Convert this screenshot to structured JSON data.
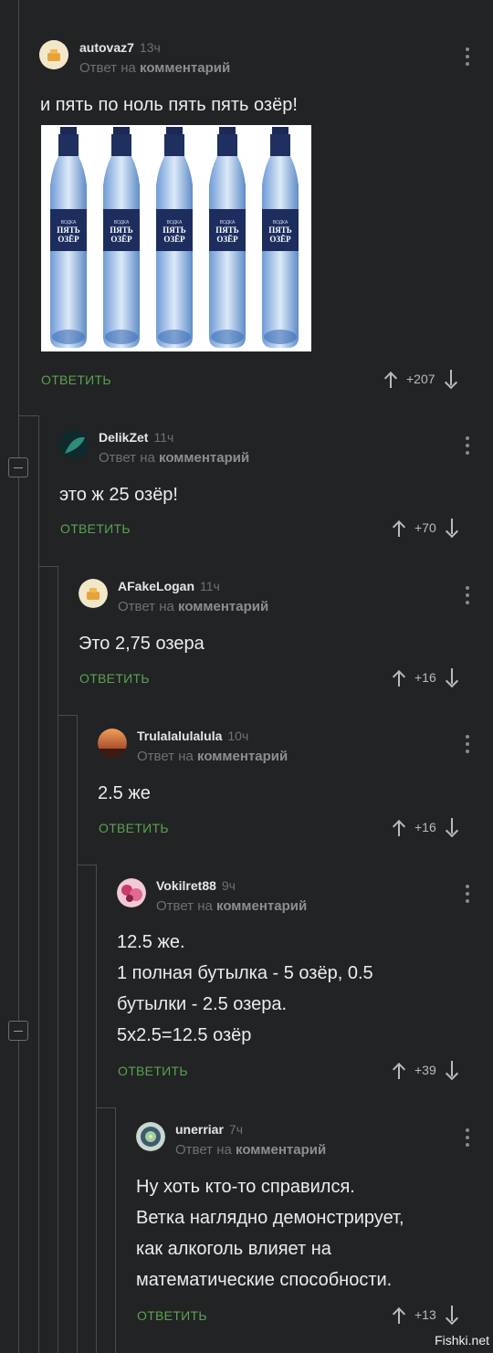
{
  "comments": [
    {
      "author": "autovaz7",
      "time": "13ч",
      "reply_prefix": "Ответ на",
      "reply_target": "комментарий",
      "text": "и пять по ноль пять пять озёр!",
      "reply_label": "ОТВЕТИТЬ",
      "score": "+207",
      "image": {
        "bottles": 5,
        "label_line1": "ПЯТЬ",
        "label_line2": "ОЗЁР",
        "label_small": "ВОДКА"
      }
    },
    {
      "author": "DelikZet",
      "time": "11ч",
      "reply_prefix": "Ответ на",
      "reply_target": "комментарий",
      "text": "это ж 25 озёр!",
      "reply_label": "ОТВЕТИТЬ",
      "score": "+70"
    },
    {
      "author": "AFakeLogan",
      "time": "11ч",
      "reply_prefix": "Ответ на",
      "reply_target": "комментарий",
      "text": "Это 2,75 озера",
      "reply_label": "ОТВЕТИТЬ",
      "score": "+16"
    },
    {
      "author": "Trulalalulalula",
      "time": "10ч",
      "reply_prefix": "Ответ на",
      "reply_target": "комментарий",
      "text": "2.5 же",
      "reply_label": "ОТВЕТИТЬ",
      "score": "+16"
    },
    {
      "author": "Vokilret88",
      "time": "9ч",
      "reply_prefix": "Ответ на",
      "reply_target": "комментарий",
      "text": "12.5 же.\n1 полная бутылка - 5 озёр, 0.5\nбутылки - 2.5 озера.\n5х2.5=12.5 озёр",
      "reply_label": "ОТВЕТИТЬ",
      "score": "+39"
    },
    {
      "author": "unerriar",
      "time": "7ч",
      "reply_prefix": "Ответ на",
      "reply_target": "комментарий",
      "text": "Ну хоть кто-то справился.\nВетка наглядно демонстрирует,\nкак алкоголь влияет на\nматематические способности.",
      "reply_label": "ОТВЕТИТЬ",
      "score": "+13"
    }
  ],
  "watermark": "Fishki.net",
  "colors": {
    "background": "#222325",
    "accent_green": "#59a34f",
    "muted": "#6f7074",
    "thread_line": "#4a4b4e"
  },
  "icons": [
    "upvote-icon",
    "downvote-icon",
    "more-dots-icon",
    "collapse-icon"
  ]
}
